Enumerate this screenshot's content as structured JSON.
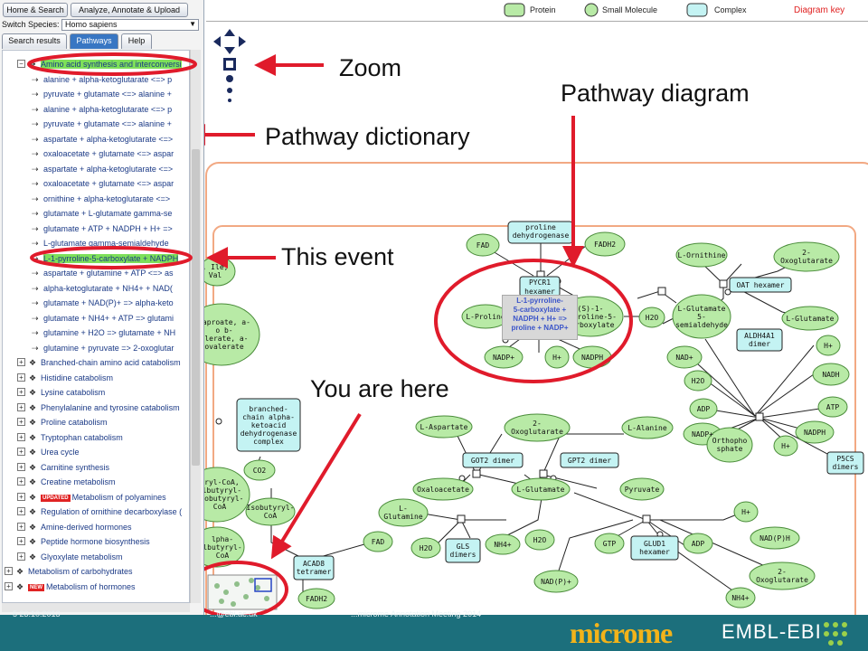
{
  "browser": {
    "home_button": "Home & Search",
    "analyze_button": "Analyze, Annotate & Upload",
    "species_label": "Switch Species:",
    "species_value": "Homo sapiens",
    "tabs": [
      "Search results",
      "Pathways",
      "Help"
    ],
    "tree_items": [
      {
        "label": "Amino acid synthesis and interconversi",
        "highlight": true,
        "kind": "expanded"
      },
      {
        "label": "alanine + alpha-ketoglutarate <=> p",
        "kind": "event"
      },
      {
        "label": "pyruvate + glutamate <=> alanine +",
        "kind": "event"
      },
      {
        "label": "alanine + alpha-ketoglutarate <=> p",
        "kind": "event"
      },
      {
        "label": "pyruvate + glutamate <=> alanine +",
        "kind": "event"
      },
      {
        "label": "aspartate + alpha-ketoglutarate <=>",
        "kind": "event"
      },
      {
        "label": "oxaloacetate + glutamate <=> aspar",
        "kind": "event"
      },
      {
        "label": "aspartate + alpha-ketoglutarate <=>",
        "kind": "event"
      },
      {
        "label": "oxaloacetate + glutamate <=> aspar",
        "kind": "event"
      },
      {
        "label": "ornithine + alpha-ketoglutarate <=>",
        "kind": "event"
      },
      {
        "label": "glutamate + L-glutamate gamma-se",
        "kind": "event"
      },
      {
        "label": "glutamate + ATP + NADPH + H+ =>",
        "kind": "event"
      },
      {
        "label": "L-glutamate gamma-semialdehyde",
        "kind": "event"
      },
      {
        "label": "L-1-pyrroline-5-carboxylate + NADPH",
        "highlight": true,
        "kind": "event"
      },
      {
        "label": "aspartate + glutamine + ATP <=> as",
        "kind": "event"
      },
      {
        "label": "alpha-ketoglutarate + NH4+ + NAD(",
        "kind": "event"
      },
      {
        "label": "glutamate + NAD(P)+ => alpha-keto",
        "kind": "event"
      },
      {
        "label": "glutamate + NH4+ + ATP => glutami",
        "kind": "event"
      },
      {
        "label": "glutamine + H2O => glutamate + NH",
        "kind": "event"
      },
      {
        "label": "glutamine + pyruvate => 2-oxoglutar",
        "kind": "event"
      },
      {
        "label": "Branched-chain amino acid catabolism",
        "kind": "pathway"
      },
      {
        "label": "Histidine catabolism",
        "kind": "pathway"
      },
      {
        "label": "Lysine catabolism",
        "kind": "pathway"
      },
      {
        "label": "Phenylalanine and tyrosine catabolism",
        "kind": "pathway"
      },
      {
        "label": "Proline catabolism",
        "kind": "pathway"
      },
      {
        "label": "Tryptophan catabolism",
        "kind": "pathway"
      },
      {
        "label": "Urea cycle",
        "kind": "pathway"
      },
      {
        "label": "Carnitine synthesis",
        "kind": "pathway"
      },
      {
        "label": "Creatine metabolism",
        "kind": "pathway"
      },
      {
        "label": "Metabolism of polyamines",
        "kind": "pathway",
        "badge": "UPDATED"
      },
      {
        "label": "Regulation of ornithine decarboxylase (",
        "kind": "pathway"
      },
      {
        "label": "Amine-derived hormones",
        "kind": "pathway"
      },
      {
        "label": "Peptide hormone biosynthesis",
        "kind": "pathway"
      },
      {
        "label": "Glyoxylate metabolism",
        "kind": "pathway"
      },
      {
        "label": "Metabolism of carbohydrates",
        "kind": "top"
      },
      {
        "label": "Metabolism of hormones",
        "kind": "top",
        "badge": "NEW"
      }
    ]
  },
  "diagram_key": {
    "title": "Diagram key",
    "protein": "Protein",
    "small_molecule": "Small Molecule",
    "complex": "Complex"
  },
  "annotations": {
    "zoom": "Zoom",
    "pathway_diagram": "Pathway diagram",
    "pathway_dictionary": "Pathway dictionary",
    "this_event": "This event",
    "you_are_here": "You are here"
  },
  "nodes": {
    "proline_dehydrogenase": [
      "proline",
      "dehydrogenase"
    ],
    "fad1": "FAD",
    "fadh2_1": "FADH2",
    "pycr1": "PYCR1",
    "pycr1_sub": "hexamer",
    "l_proline": "L-Proline",
    "p5c": [
      "(S)-1-",
      "Pyrroline-5-",
      "carboxylate"
    ],
    "nadp1": "NADP+",
    "h1": "H+",
    "nadph1": "NADPH",
    "event_tooltip": [
      "L-1-pyrroline-",
      "5-carboxylate +",
      "NADPH + H+ =>",
      "proline + NADP+"
    ],
    "l_ornithine": "L-Ornithine",
    "oxoglutarate1": [
      "2-",
      "Oxoglutarate"
    ],
    "oat_hexamer": "OAT hexamer",
    "h2o1": "H2O",
    "l_glutamate_semi": [
      "L-Glutamate",
      "5-",
      "semialdehyde"
    ],
    "l_glutamate1": "L-Glutamate",
    "aldh4a1": [
      "ALDH4A1",
      "dimer"
    ],
    "h2": "H+",
    "nad1": "NAD+",
    "nadh1": "NADH",
    "h2o2": "H2O",
    "atp1": "ATP",
    "adp1": "ADP",
    "nadph2": "NADPH",
    "nadp2": "NADP+",
    "orthophosphate": [
      "Orthopho",
      "sphate"
    ],
    "h3": "H+",
    "p5cs": [
      "P5CS",
      "dimers"
    ],
    "l_aspartate": "L-Aspartate",
    "oxoglutarate2": [
      "2-",
      "Oxoglutarate"
    ],
    "l_alanine": "L-Alanine",
    "got2": "GOT2 dimer",
    "gpt2": "GPT2 dimer",
    "oxaloacetate": "Oxaloacetate",
    "l_glutamate2": "L-Glutamate",
    "pyruvate": "Pyruvate",
    "l_glutamine": [
      "L-",
      "Glutamine"
    ],
    "h2o3": "H2O",
    "gls": [
      "GLS",
      "dimers"
    ],
    "nh4_1": "NH4+",
    "h2o4": "H2O",
    "gtp": "GTP",
    "glud1": [
      "GLUD1",
      "hexamer"
    ],
    "adp2": "ADP",
    "h4": "H+",
    "nadph3": "NAD(P)H",
    "nadp3": "NAD(P)+",
    "oxoglutarate3": [
      "2-",
      "Oxoglutarate"
    ],
    "nh4_2": "NH4+",
    "branched_complex": [
      "branched-",
      "chain alpha-",
      "ketoacid",
      "dehydrogenase",
      "complex"
    ],
    "co2": "CO2",
    "isobutyryl": [
      "Isobutyryl-",
      "CoA"
    ],
    "fad2": "FAD",
    "acad8": [
      "ACAD8",
      "tetramer"
    ],
    "fadh2_2": "FADH2",
    "partial_ile": [
      ", Ile,",
      "Val"
    ],
    "partial_caproate": [
      "caproate, a-",
      "o b-",
      "alerate, a-",
      "ovalerate"
    ],
    "partial_coa1": [
      "eryl-CoA,",
      "ylbutyryl-",
      "isobutyryl-",
      "CoA"
    ],
    "partial_coa2": [
      "lpha-",
      "lbutyryl-",
      "CoA"
    ]
  },
  "footer": {
    "left_text": "5      23.10.2013",
    "mid_text": "...@ebi.ac.uk",
    "right_text": "...microme Annotation Meeting 2014",
    "brand": "microme",
    "org": "EMBL-EBI"
  },
  "colors": {
    "molecule_fill": "#b8eaa6",
    "complex_fill": "#c4f3f3",
    "annotation_red": "#e01b2b",
    "compartment": "#f2a983",
    "footer": "#1c6f7c"
  }
}
